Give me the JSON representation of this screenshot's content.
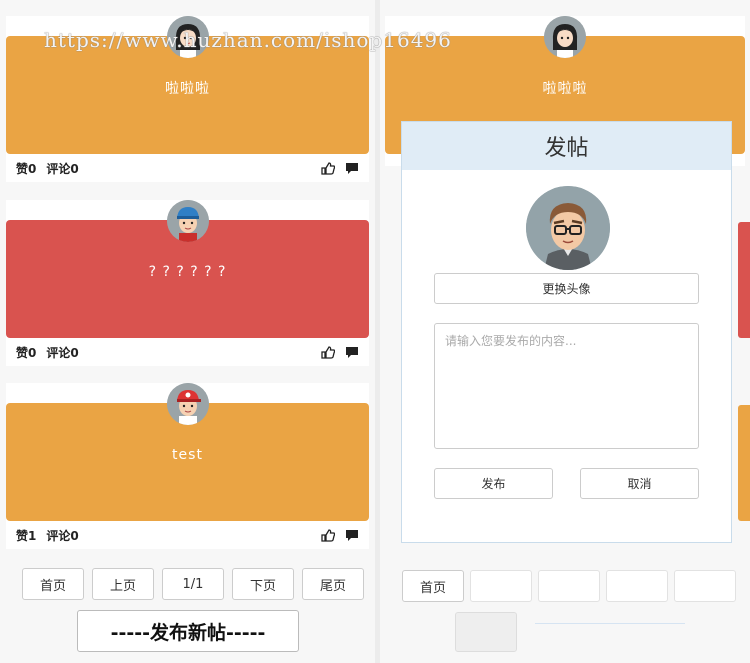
{
  "watermark": "https://www.huzhan.com/ishop16496",
  "colors": {
    "orange": "#eaa444",
    "red": "#d9534f",
    "modal_header": "#e0ecf6"
  },
  "posts": [
    {
      "content": "啦啦啦",
      "likes_label": "赞0",
      "comments_label": "评论0",
      "avatar": "girl-avatar",
      "color": "orange"
    },
    {
      "content": "? ? ? ? ? ?",
      "likes_label": "赞0",
      "comments_label": "评论0",
      "avatar": "boy-blue-cap-avatar",
      "color": "red"
    },
    {
      "content": "test",
      "likes_label": "赞1",
      "comments_label": "评论0",
      "avatar": "boy-red-cap-avatar",
      "color": "orange"
    }
  ],
  "pager": {
    "first": "首页",
    "prev": "上页",
    "page": "1/1",
    "next": "下页",
    "last": "尾页"
  },
  "publish_new_label": "-----发布新帖-----",
  "right_preview": {
    "content": "啦啦啦",
    "first_label": "首页"
  },
  "modal": {
    "title": "发帖",
    "change_avatar_label": "更换头像",
    "textarea_placeholder": "请输入您要发布的内容...",
    "submit_label": "发布",
    "cancel_label": "取消"
  },
  "icons": {
    "like": "thumbs-up-icon",
    "comment": "comment-icon"
  }
}
